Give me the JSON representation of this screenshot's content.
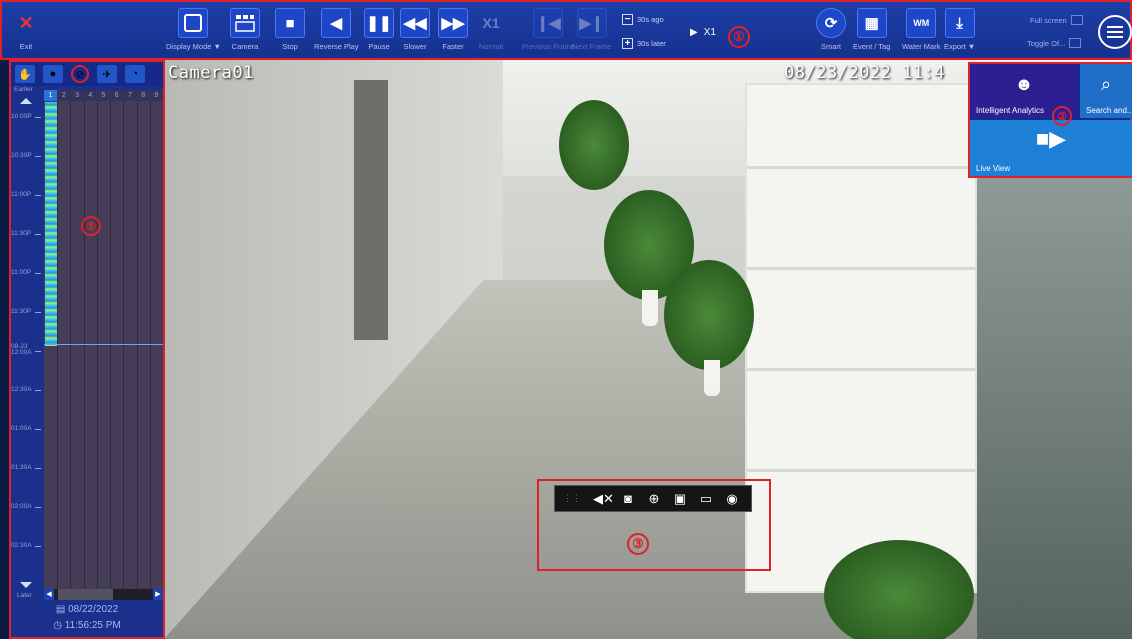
{
  "toolbar": {
    "exit_label": "Exit",
    "display_mode_label": "Display Mode ▼",
    "camera_label": "Camera",
    "stop_label": "Stop",
    "reverse_play_label": "Reverse Play",
    "pause_label": "Pause",
    "slower_label": "Slower",
    "faster_label": "Faster",
    "speed_badge": "X1",
    "normal_label": "Normal",
    "prev_frame_label": "Previous Frame",
    "next_frame_label": "Next Frame",
    "skip_back_label": "30s ago",
    "skip_fwd_label": "30s later",
    "speed_indicator": "X1",
    "smart_label": "Smart",
    "event_tag_label": "Event / Tag",
    "watermark_badge": "WM",
    "watermark_label": "Water Mark",
    "export_label": "Export ▼",
    "fullscreen_label": "Full screen",
    "toggle_label": "Toggle Of...",
    "callout": "①"
  },
  "camera": {
    "name": "Camera01",
    "timestamp": "08/23/2022 11:4"
  },
  "quick_menu": {
    "intelligent_analytics": "Intelligent Analytics",
    "search": "Search and...",
    "live_view": "Live View",
    "callout": "②"
  },
  "timeline": {
    "earlier_label": "Earlier",
    "later_label": "Later",
    "channels": [
      "1",
      "2",
      "3",
      "4",
      "5",
      "6",
      "7",
      "8",
      "9"
    ],
    "active_channel": "1",
    "time_labels": [
      "10:00P",
      "10:30P",
      "11:00P",
      "11:30P",
      "11:00P",
      "11:30P",
      "08-23\n12:00A",
      "12:30A",
      "01:00A",
      "01:30A",
      "02:00A",
      "02:30A"
    ],
    "date": "08/22/2022",
    "time": "11:56:25 PM",
    "callout": "⑤"
  },
  "floating_bar": {
    "callout": "③",
    "icons": [
      "mute-icon",
      "snapshot-icon",
      "zoom-icon",
      "bookmark-icon",
      "clip-icon",
      "more-icon"
    ]
  },
  "colors": {
    "accent": "#1d47c7",
    "callout_red": "#e0202a",
    "recording": "#33d3ea"
  }
}
